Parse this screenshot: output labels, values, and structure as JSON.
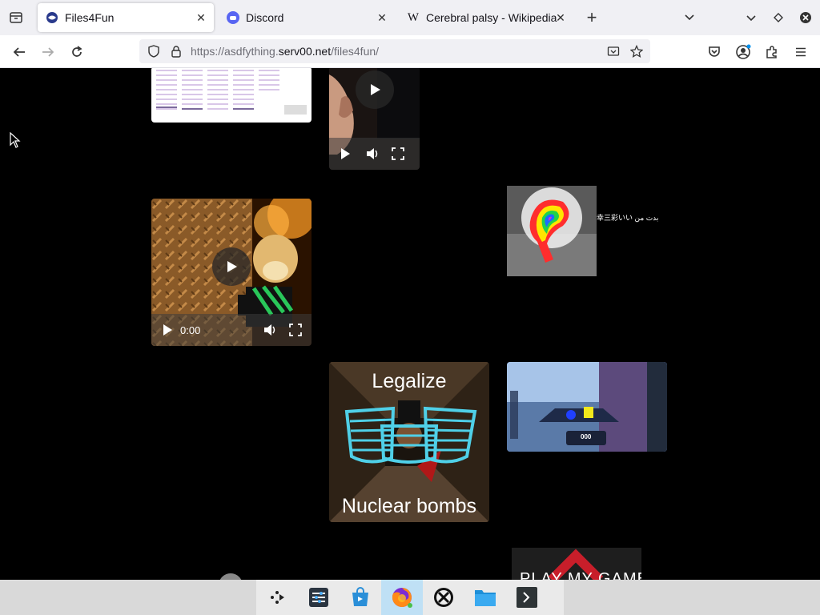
{
  "browser": {
    "tabs": [
      {
        "label": "Files4Fun",
        "active": true,
        "icon": "globe-icon"
      },
      {
        "label": "Discord",
        "active": false,
        "icon": "discord-icon"
      },
      {
        "label": "Cerebral palsy - Wikipedia",
        "active": false,
        "icon": "wikipedia-icon"
      }
    ],
    "url_prefix": "https://asdfything.",
    "url_host": "serv00.net",
    "url_path": "/files4fun/"
  },
  "content": {
    "video2": {
      "time": "0:00"
    },
    "image_caption_top": "Legalize",
    "image_caption_bottom": "Nuclear bombs",
    "image_side_text": "幸三彩いい بدت من",
    "promo_text": "PLAY MY GAME",
    "game_score": "000"
  },
  "colors": {
    "accent": "#0060df",
    "page_bg": "#000000",
    "chrome_bg": "#f0f0f4"
  }
}
